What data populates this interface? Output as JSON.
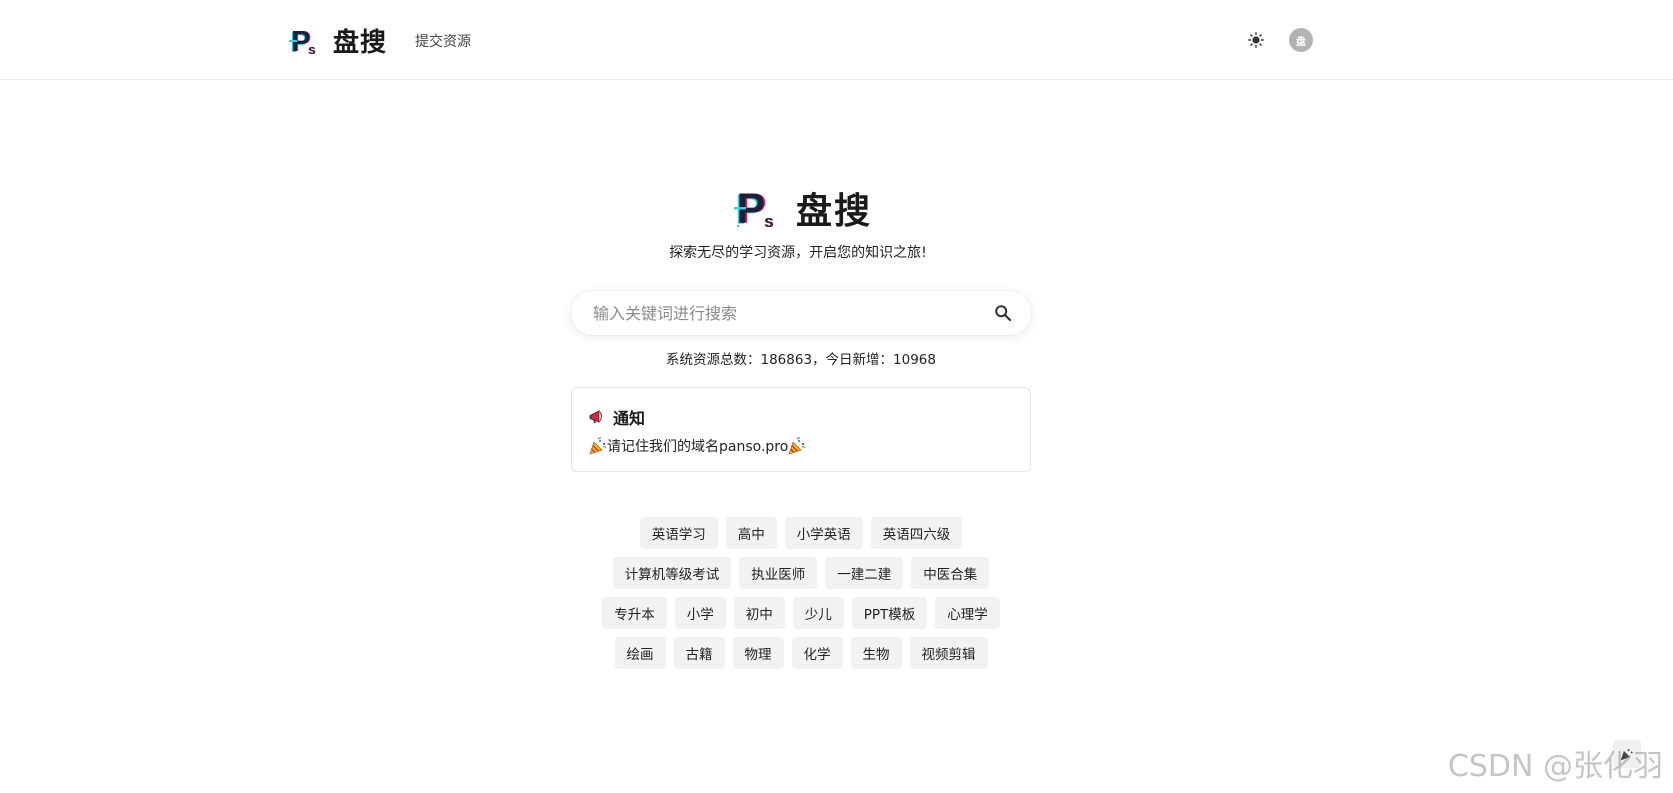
{
  "header": {
    "brand_name": "盘搜",
    "nav_submit": "提交资源",
    "avatar_char": "盘"
  },
  "hero": {
    "name": "盘搜",
    "tagline": "探索无尽的学习资源，开启您的知识之旅!"
  },
  "search": {
    "placeholder": "输入关键词进行搜索",
    "value": ""
  },
  "stats": {
    "text": "系统资源总数：186863，今日新增：10968"
  },
  "notice": {
    "title": "通知",
    "body": "请记住我们的域名panso.pro"
  },
  "tags": [
    [
      "英语学习",
      "高中",
      "小学英语",
      "英语四六级"
    ],
    [
      "计算机等级考试",
      "执业医师",
      "一建二建",
      "中医合集"
    ],
    [
      "专升本",
      "小学",
      "初中",
      "少儿",
      "PPT模板",
      "心理学"
    ],
    [
      "绘画",
      "古籍",
      "物理",
      "化学",
      "生物",
      "视频剪辑"
    ]
  ],
  "watermark": "CSDN @张化羽",
  "icons": {
    "logo": "ps-logo-icon",
    "theme": "sun-icon",
    "search": "search-icon",
    "notice": "megaphone-icon",
    "party": "party-popper-icon"
  },
  "colors": {
    "logo_dark": "#1f1f3a",
    "logo_cyan": "#2fd6e0",
    "logo_pink": "#e0245e",
    "tag_bg": "#f2f2f2"
  }
}
